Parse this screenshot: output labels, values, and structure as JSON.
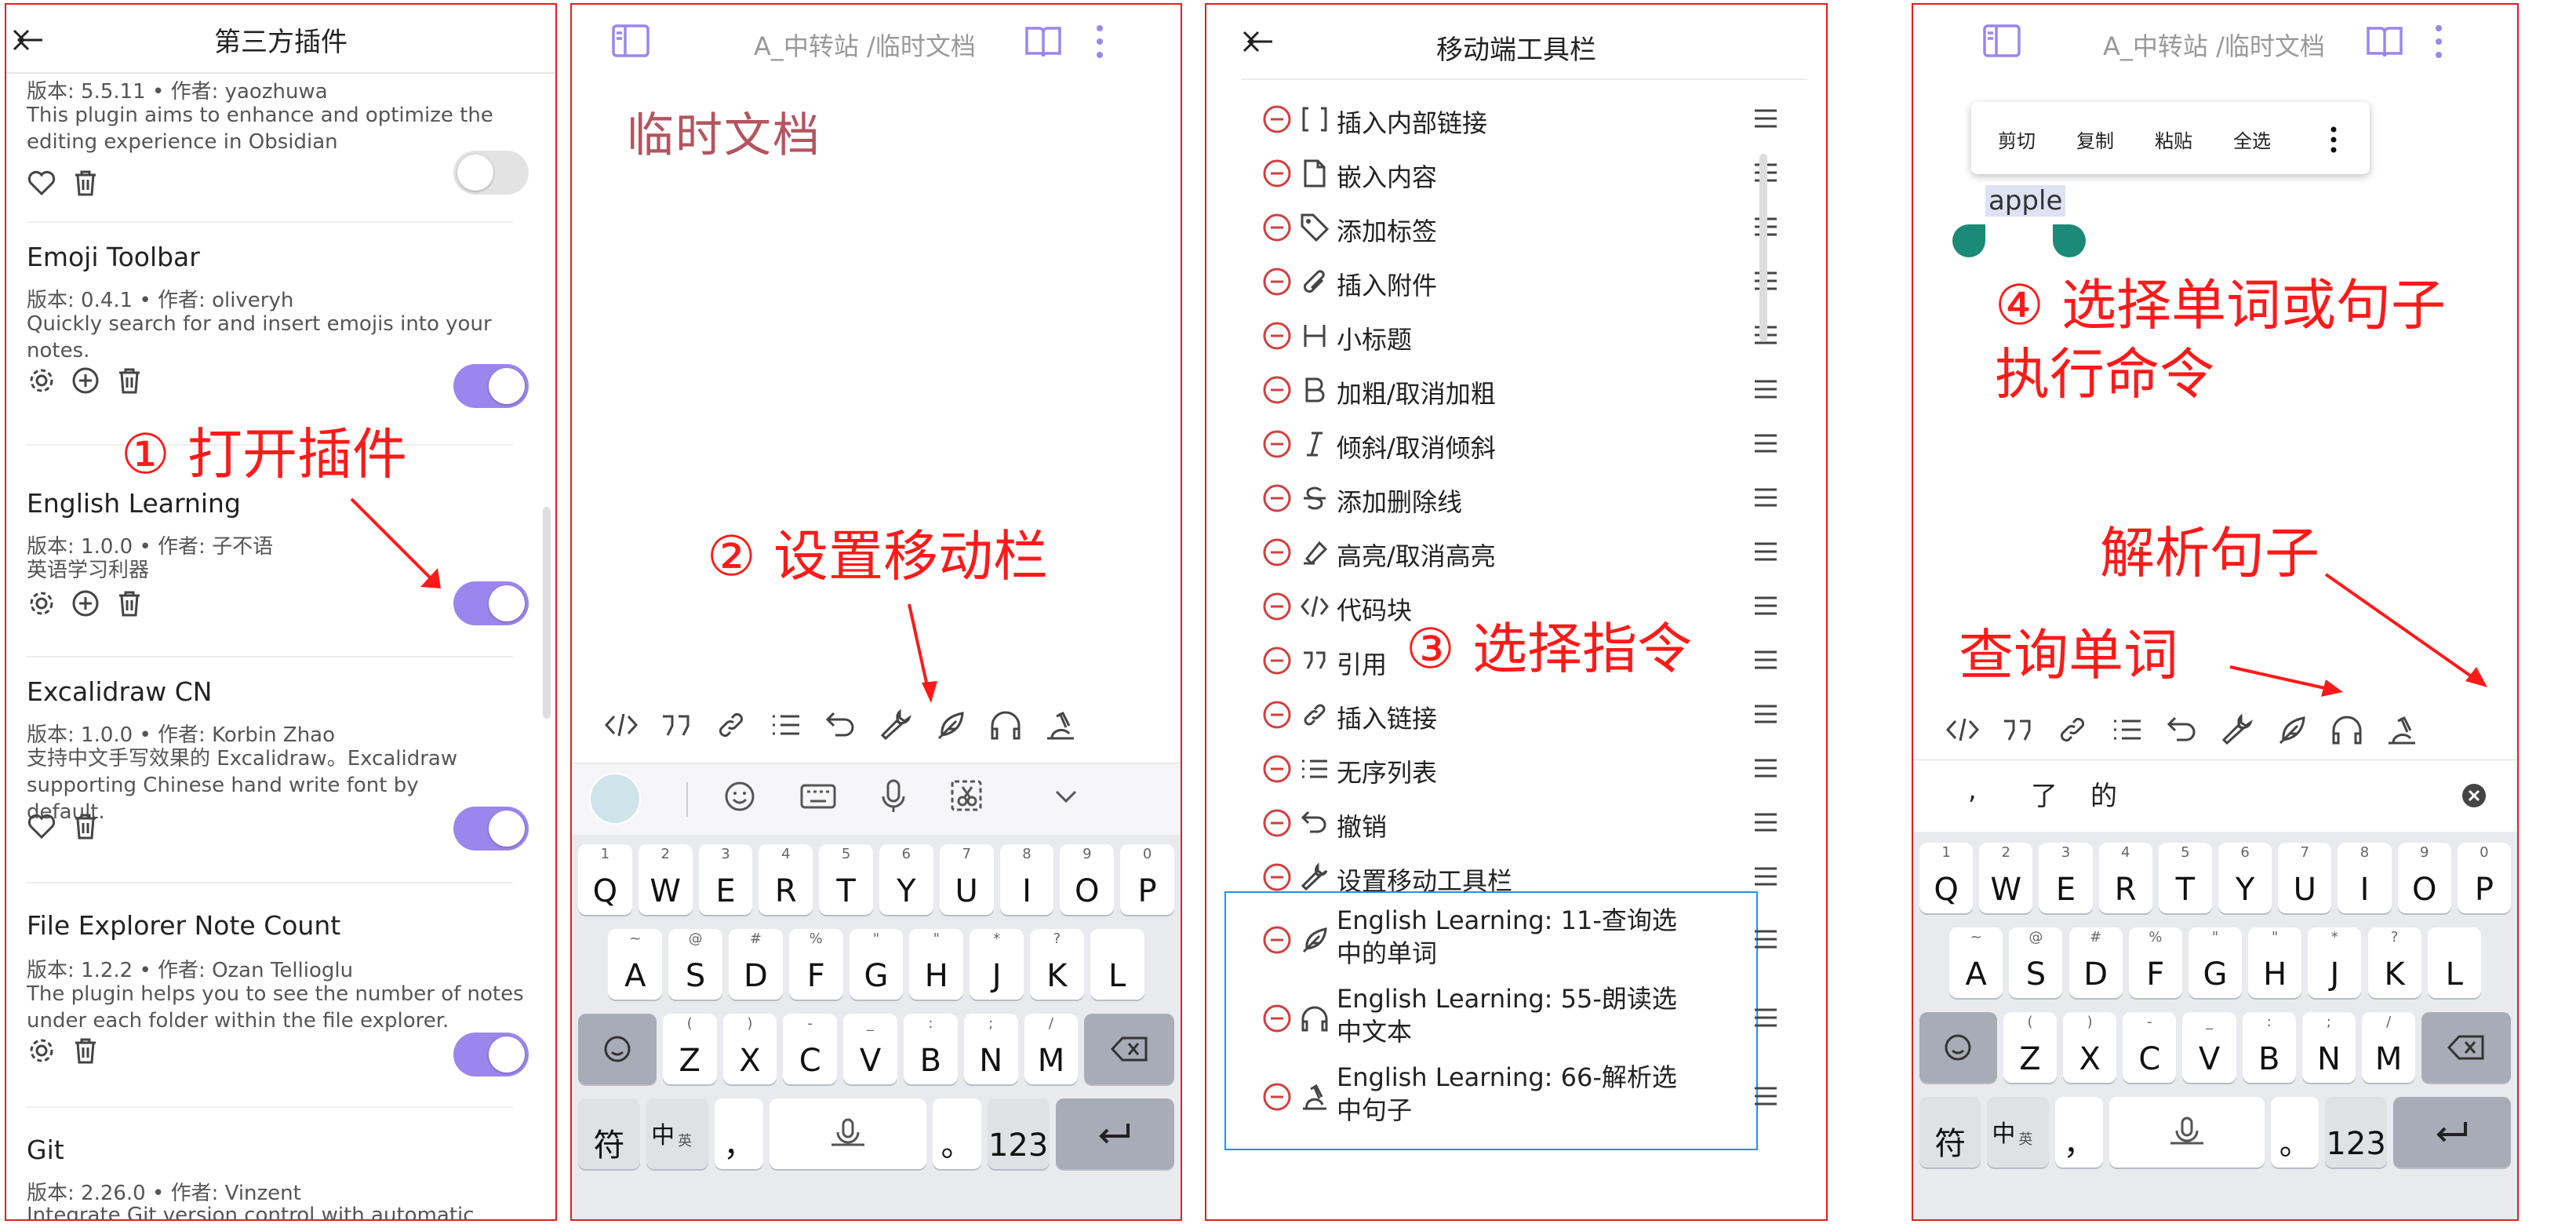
{
  "panel1": {
    "title": "第三方插件",
    "plugins": [
      {
        "meta": "版本: 5.5.11 • 作者: yaozhuwa",
        "desc": "This plugin aims to enhance and optimize the editing experience in Obsidian",
        "enabled": false
      },
      {
        "name": "Emoji Toolbar",
        "meta": "版本: 0.4.1 • 作者: oliveryh",
        "desc": "Quickly search for and insert emojis into your notes.",
        "enabled": true
      },
      {
        "name": "English Learning",
        "meta": "版本: 1.0.0 • 作者: 子不语",
        "desc": "英语学习利器",
        "enabled": true
      },
      {
        "name": "Excalidraw CN",
        "meta": "版本: 1.0.0 • 作者: Korbin Zhao",
        "desc": "支持中文手写效果的 Excalidraw。Excalidraw supporting Chinese hand write font by default.",
        "enabled": true
      },
      {
        "name": "File Explorer Note Count",
        "meta": "版本: 1.2.2 • 作者: Ozan Tellioglu",
        "desc": "The plugin helps you to see the number of notes under each folder within the file explorer.",
        "enabled": true
      },
      {
        "name": "Git",
        "meta": "版本: 2.26.0 • 作者: Vinzent",
        "desc": "Integrate Git version control with automatic"
      }
    ],
    "annotation": "① 打开插件"
  },
  "panel2": {
    "breadcrumb_folder": "A_中转站",
    "breadcrumb_sep": "/",
    "breadcrumb_file": "临时文档",
    "note_title": "临时文档",
    "annotation": "② 设置移动栏"
  },
  "panel3": {
    "title": "移动端工具栏",
    "commands": [
      {
        "icon": "brackets-icon",
        "label": "插入内部链接"
      },
      {
        "icon": "file-icon",
        "label": "嵌入内容"
      },
      {
        "icon": "tag-icon",
        "label": "添加标签"
      },
      {
        "icon": "paperclip-icon",
        "label": "插入附件"
      },
      {
        "icon": "heading-icon",
        "label": "小标题"
      },
      {
        "icon": "bold-icon",
        "label": "加粗/取消加粗"
      },
      {
        "icon": "italic-icon",
        "label": "倾斜/取消倾斜"
      },
      {
        "icon": "strikethrough-icon",
        "label": "添加删除线"
      },
      {
        "icon": "highlighter-icon",
        "label": "高亮/取消高亮"
      },
      {
        "icon": "code-icon",
        "label": "代码块"
      },
      {
        "icon": "quote-icon",
        "label": "引用"
      },
      {
        "icon": "link-icon",
        "label": "插入链接"
      },
      {
        "icon": "list-icon",
        "label": "无序列表"
      },
      {
        "icon": "undo-icon",
        "label": "撤销"
      },
      {
        "icon": "wrench-icon",
        "label": "设置移动工具栏"
      }
    ],
    "english_commands": [
      {
        "icon": "feather-icon",
        "label": "English Learning: 11-查询选中的单词"
      },
      {
        "icon": "headphones-icon",
        "label": "English Learning: 55-朗读选中文本"
      },
      {
        "icon": "analyze-icon",
        "label": "English Learning: 66-解析选中句子"
      }
    ],
    "annotation": "③ 选择指令"
  },
  "panel4": {
    "breadcrumb_folder": "A_中转站",
    "breadcrumb_sep": "/",
    "breadcrumb_file": "临时文档",
    "context_menu": [
      "剪切",
      "复制",
      "粘贴",
      "全选"
    ],
    "selected_word": "apple",
    "annotation_main": "④ 选择单词或句子\n执行命令",
    "annotation_parse": "解析句子",
    "annotation_lookup": "查询单词",
    "suggestions": [
      ",",
      "了",
      "的"
    ]
  },
  "keyboard": {
    "row1": [
      {
        "k": "Q",
        "s": "1"
      },
      {
        "k": "W",
        "s": "2"
      },
      {
        "k": "E",
        "s": "3"
      },
      {
        "k": "R",
        "s": "4"
      },
      {
        "k": "T",
        "s": "5"
      },
      {
        "k": "Y",
        "s": "6"
      },
      {
        "k": "U",
        "s": "7"
      },
      {
        "k": "I",
        "s": "8"
      },
      {
        "k": "O",
        "s": "9"
      },
      {
        "k": "P",
        "s": "0"
      }
    ],
    "row2": [
      {
        "k": "A",
        "s": "~"
      },
      {
        "k": "S",
        "s": "@"
      },
      {
        "k": "D",
        "s": "#"
      },
      {
        "k": "F",
        "s": "%"
      },
      {
        "k": "G",
        "s": "\""
      },
      {
        "k": "H",
        "s": "\""
      },
      {
        "k": "J",
        "s": "*"
      },
      {
        "k": "K",
        "s": "?"
      },
      {
        "k": "L",
        "s": ""
      }
    ],
    "row3": [
      {
        "k": "Z",
        "s": "("
      },
      {
        "k": "X",
        "s": ")"
      },
      {
        "k": "C",
        "s": "-"
      },
      {
        "k": "V",
        "s": "_"
      },
      {
        "k": "B",
        "s": ":"
      },
      {
        "k": "N",
        "s": ";"
      },
      {
        "k": "M",
        "s": "/"
      }
    ],
    "fu": "符",
    "zh": "中",
    "ying": "英",
    "comma": "，",
    "period": "。",
    "num": "123"
  }
}
